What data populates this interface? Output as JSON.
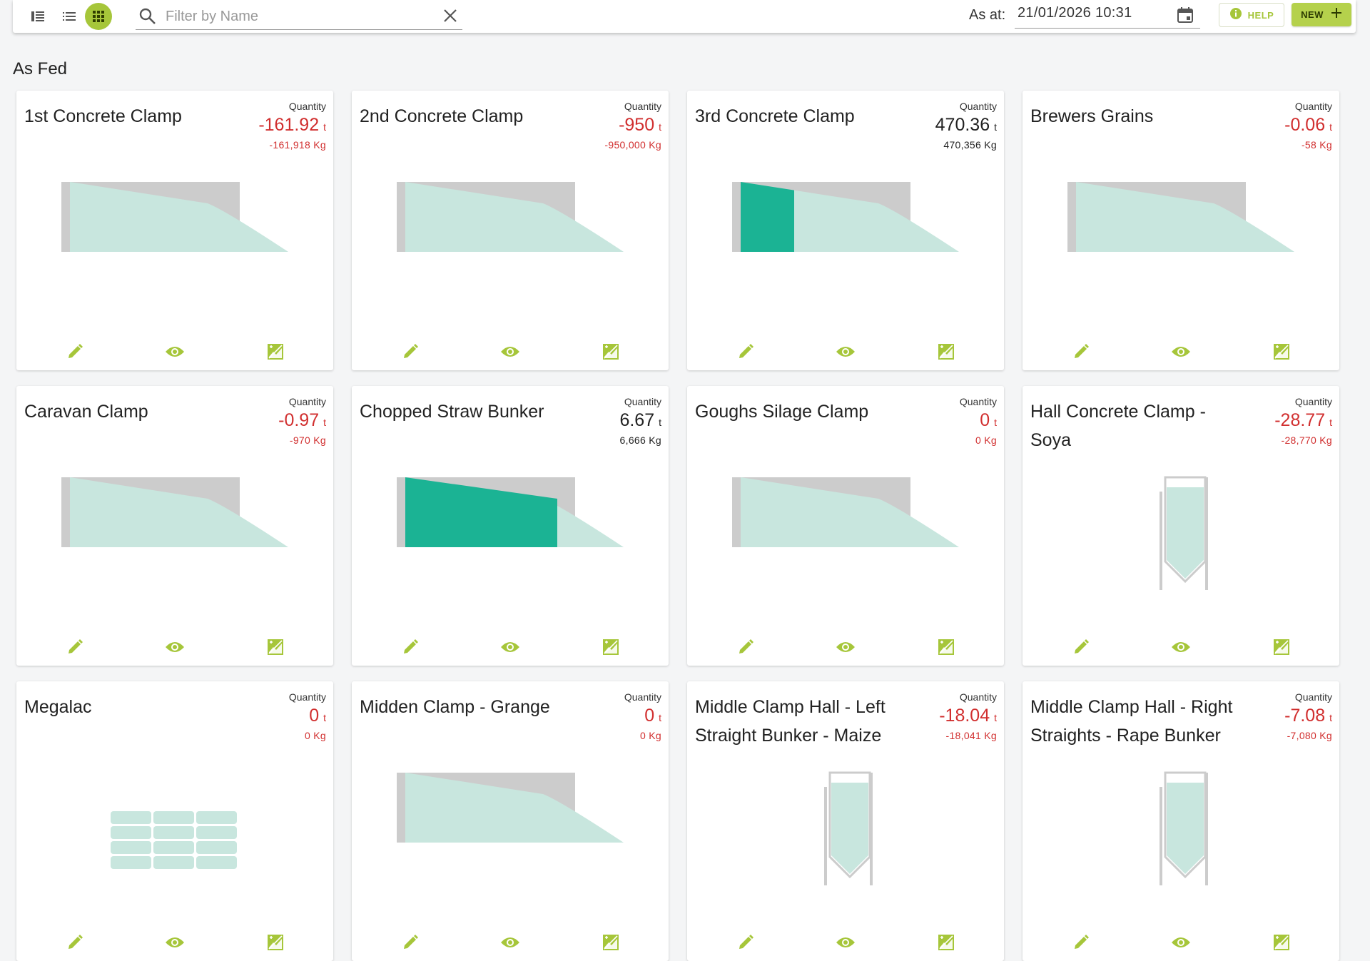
{
  "toolbar": {
    "view_icons": [
      "sidebar-list-icon",
      "list-view-icon",
      "grid-view-icon"
    ],
    "search": {
      "placeholder": "Filter by Name",
      "value": ""
    },
    "as_at": {
      "label": "As at:",
      "value": "21/01/2026 10:31"
    },
    "help_label": "HELP",
    "new_label": "NEW"
  },
  "section": {
    "title": "As Fed"
  },
  "colors": {
    "accent": "#a6c63a",
    "negative": "#d12f2f",
    "fill": "#1bb394",
    "fill_light": "#c8e6de",
    "clamp_back": "#cccccc"
  },
  "cards": [
    {
      "name": "1st Concrete Clamp",
      "quantity_label": "Quantity",
      "quantity": "-161.92",
      "unit": "t",
      "kg": "-161,918 Kg",
      "negative": true,
      "shape": "clamp",
      "fill": 0
    },
    {
      "name": "2nd Concrete Clamp",
      "quantity_label": "Quantity",
      "quantity": "-950",
      "unit": "t",
      "kg": "-950,000 Kg",
      "negative": true,
      "shape": "clamp",
      "fill": 0
    },
    {
      "name": "3rd Concrete Clamp",
      "quantity_label": "Quantity",
      "quantity": "470.36",
      "unit": "t",
      "kg": "470,356 Kg",
      "negative": false,
      "shape": "clamp",
      "fill": 0.25
    },
    {
      "name": "Brewers Grains",
      "quantity_label": "Quantity",
      "quantity": "-0.06",
      "unit": "t",
      "kg": "-58 Kg",
      "negative": true,
      "shape": "clamp",
      "fill": 0
    },
    {
      "name": "Caravan Clamp",
      "quantity_label": "Quantity",
      "quantity": "-0.97",
      "unit": "t",
      "kg": "-970 Kg",
      "negative": true,
      "shape": "clamp",
      "fill": 0
    },
    {
      "name": "Chopped Straw Bunker",
      "quantity_label": "Quantity",
      "quantity": "6.67",
      "unit": "t",
      "kg": "6,666 Kg",
      "negative": false,
      "shape": "clamp",
      "fill": 0.71
    },
    {
      "name": "Goughs Silage Clamp",
      "quantity_label": "Quantity",
      "quantity": "0",
      "unit": "t",
      "kg": "0 Kg",
      "negative": true,
      "shape": "clamp",
      "fill": 0
    },
    {
      "name": "Hall Concrete Clamp - Soya",
      "quantity_label": "Quantity",
      "quantity": "-28.77",
      "unit": "t",
      "kg": "-28,770 Kg",
      "negative": true,
      "shape": "silo",
      "fill": 0
    },
    {
      "name": "Megalac",
      "quantity_label": "Quantity",
      "quantity": "0",
      "unit": "t",
      "kg": "0 Kg",
      "negative": true,
      "shape": "bags",
      "fill": 0
    },
    {
      "name": "Midden Clamp - Grange",
      "quantity_label": "Quantity",
      "quantity": "0",
      "unit": "t",
      "kg": "0 Kg",
      "negative": true,
      "shape": "clamp",
      "fill": 0
    },
    {
      "name": "Middle Clamp Hall - Left Straight Bunker - Maize",
      "quantity_label": "Quantity",
      "quantity": "-18.04",
      "unit": "t",
      "kg": "-18,041 Kg",
      "negative": true,
      "shape": "silo",
      "fill": 0
    },
    {
      "name": "Middle Clamp Hall - Right Straights - Rape Bunker",
      "quantity_label": "Quantity",
      "quantity": "-7.08",
      "unit": "t",
      "kg": "-7,080 Kg",
      "negative": true,
      "shape": "silo",
      "fill": 0
    }
  ]
}
